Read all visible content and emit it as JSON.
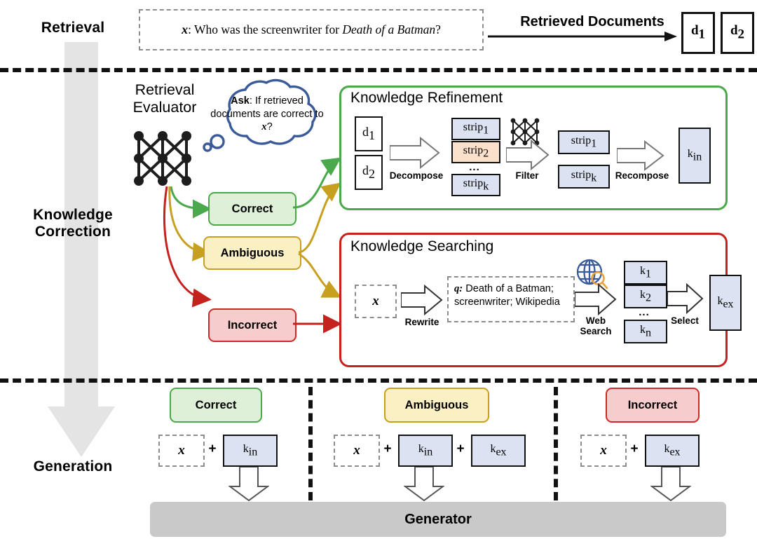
{
  "stages": {
    "retrieval": "Retrieval",
    "knowledge_correction_l1": "Knowledge",
    "knowledge_correction_l2": "Correction",
    "generation": "Generation"
  },
  "retrieval": {
    "query_var": "x",
    "query_sep": ": ",
    "query_head": "Who was the screenwriter for ",
    "query_title": "Death of a Batman",
    "query_tail": "?",
    "arrow_label": "Retrieved Documents",
    "docs": [
      {
        "base": "d",
        "sub": "1"
      },
      {
        "base": "d",
        "sub": "2"
      }
    ]
  },
  "evaluator": {
    "name_line1": "Retrieval",
    "name_line2": "Evaluator",
    "bubble_bold": "Ask",
    "bubble_rest": ": If retrieved documents are correct to ",
    "bubble_var": "x",
    "bubble_end": "?",
    "labels": {
      "correct": "Correct",
      "ambiguous": "Ambiguous",
      "incorrect": "Incorrect"
    }
  },
  "refinement": {
    "title": "Knowledge Refinement",
    "docs": [
      {
        "base": "d",
        "sub": "1"
      },
      {
        "base": "d",
        "sub": "2"
      }
    ],
    "step_decompose": "Decompose",
    "strips_in": [
      {
        "base": "strip",
        "sub": "1",
        "tone": "blue"
      },
      {
        "base": "strip",
        "sub": "2",
        "tone": "peach"
      }
    ],
    "ellipsis": "...",
    "strip_last": {
      "base": "strip",
      "sub": "k",
      "tone": "blue"
    },
    "step_filter": "Filter",
    "strips_out": [
      {
        "base": "strip",
        "sub": "1"
      },
      {
        "base": "strip",
        "sub": "k"
      }
    ],
    "step_recompose": "Recompose",
    "output": {
      "base": "k",
      "sub": "in"
    }
  },
  "searching": {
    "title": "Knowledge Searching",
    "input_var": "x",
    "step_rewrite": "Rewrite",
    "rewritten_label": "q:",
    "rewritten_line1": "Death of a Batman;",
    "rewritten_line2": "screenwriter; Wikipedia",
    "step_web_l1": "Web",
    "step_web_l2": "Search",
    "results": [
      {
        "base": "k",
        "sub": "1"
      },
      {
        "base": "k",
        "sub": "2"
      }
    ],
    "ellipsis": "...",
    "result_last": {
      "base": "k",
      "sub": "n"
    },
    "step_select": "Select",
    "output": {
      "base": "k",
      "sub": "ex"
    }
  },
  "generation": {
    "columns": [
      {
        "label": "Correct",
        "tone": "correct",
        "var": "x",
        "plus": "+",
        "items": [
          {
            "base": "k",
            "sub": "in"
          }
        ]
      },
      {
        "label": "Ambiguous",
        "tone": "ambiguous",
        "var": "x",
        "plus": "+",
        "items": [
          {
            "base": "k",
            "sub": "in"
          },
          {
            "base": "k",
            "sub": "ex"
          }
        ]
      },
      {
        "label": "Incorrect",
        "tone": "incorrect",
        "var": "x",
        "plus": "+",
        "items": [
          {
            "base": "k",
            "sub": "ex"
          }
        ]
      }
    ],
    "generator": "Generator"
  },
  "colors": {
    "green": "#4aa94a",
    "gold": "#c8a01f",
    "red": "#c5221f",
    "blue_box": "#dbe2f1",
    "peach_box": "#fbe1cb",
    "gray_arrow": "#e2e2e2",
    "generator_bar": "#c9c9c9",
    "bubble_stroke": "#3b5a9a",
    "globe": "#3b5a9a",
    "magnifier": "#e8a33d"
  }
}
